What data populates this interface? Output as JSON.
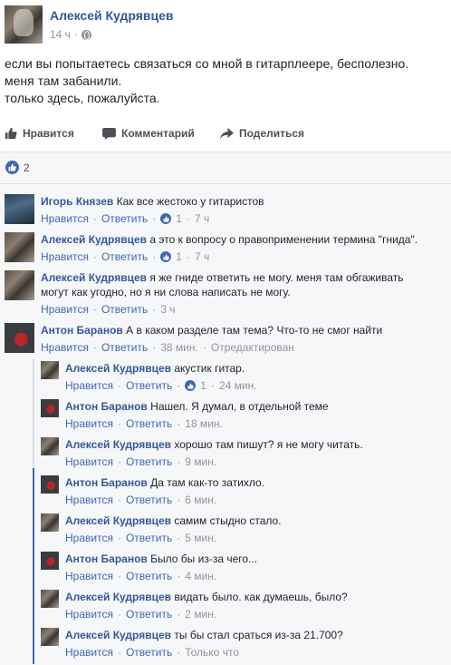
{
  "post": {
    "author": "Алексей Кудрявцев",
    "time": "14 ч",
    "lines": [
      "если вы попытаетесь связаться со мной в гитарплеере, бесполезно.",
      "меня там забанили.",
      "только здесь, пожалуйста."
    ]
  },
  "actions": {
    "like": "Нравится",
    "comment": "Комментарий",
    "share": "Поделиться"
  },
  "reactions": {
    "count": "2"
  },
  "comment_actions": {
    "like": "Нравится",
    "reply": "Ответить"
  },
  "comments": [
    {
      "author": "Игорь Князев",
      "lines": [
        "Как все жестоко у гитаристов"
      ],
      "likes": "1",
      "time": "7 ч",
      "edited": ""
    },
    {
      "author": "Алексей Кудрявцев",
      "lines": [
        "а это к вопросу о правоприменении термина \"гнида\"."
      ],
      "likes": "1",
      "time": "7 ч",
      "edited": ""
    },
    {
      "author": "Алексей Кудрявцев",
      "lines": [
        "я же гниде ответить не могу. меня там обгаживать",
        "могут как угодно, но я ни слова написать не могу."
      ],
      "likes": "",
      "time": "3 ч",
      "edited": ""
    },
    {
      "author": "Антон Баранов",
      "lines": [
        "А в каком разделе там тема? Что-то не смог найти"
      ],
      "likes": "",
      "time": "38 мин.",
      "edited": "Отредактирован"
    }
  ],
  "replies": [
    {
      "author": "Алексей Кудрявцев",
      "text": "акустик гитар.",
      "likes": "1",
      "time": "24 мин."
    },
    {
      "author": "Антон Баранов",
      "text": "Нашел. Я думал, в отдельной теме",
      "likes": "",
      "time": "18 мин."
    },
    {
      "author": "Алексей Кудрявцев",
      "text": "хорошо там пишут? я не могу читать.",
      "likes": "",
      "time": "9 мин."
    },
    {
      "author": "Антон Баранов",
      "text": "Да там как-то затихло.",
      "likes": "",
      "time": "6 мин."
    },
    {
      "author": "Алексей Кудрявцев",
      "text": "самим стыдно стало.",
      "likes": "",
      "time": "5 мин."
    },
    {
      "author": "Антон Баранов",
      "text": "Было бы из-за чего...",
      "likes": "",
      "time": "4 мин."
    },
    {
      "author": "Алексей Кудрявцев",
      "text": "видать было. как думаешь, было?",
      "likes": "",
      "time": "2 мин."
    },
    {
      "author": "Алексей Кудрявцев",
      "text": "ты бы стал сраться из-за 21.700?",
      "likes": "",
      "time": "Только что"
    }
  ],
  "colors": {
    "link": "#365899",
    "action_link": "#4267b2",
    "muted": "#90949c",
    "text": "#1d2129"
  }
}
